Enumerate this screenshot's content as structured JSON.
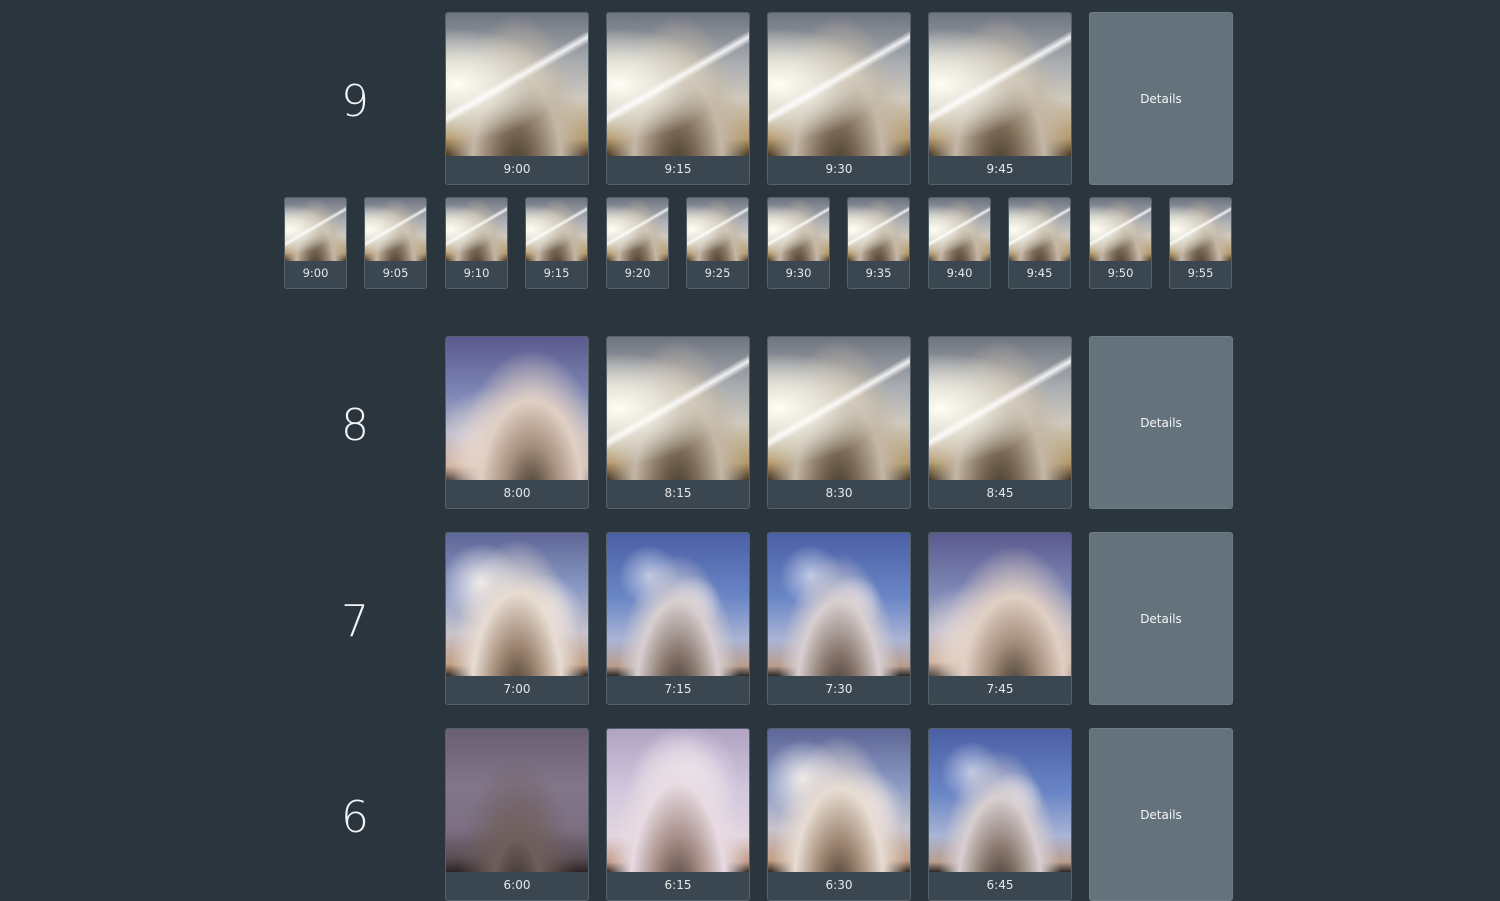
{
  "hours": [
    {
      "label": "9",
      "quarters": [
        "9:00",
        "9:15",
        "9:30",
        "9:45"
      ],
      "details_label": "Details",
      "minutes": [
        "9:00",
        "9:05",
        "9:10",
        "9:15",
        "9:20",
        "9:25",
        "9:30",
        "9:35",
        "9:40",
        "9:45",
        "9:50",
        "9:55"
      ]
    },
    {
      "label": "8",
      "quarters": [
        "8:00",
        "8:15",
        "8:30",
        "8:45"
      ],
      "details_label": "Details"
    },
    {
      "label": "7",
      "quarters": [
        "7:00",
        "7:15",
        "7:30",
        "7:45"
      ],
      "details_label": "Details"
    },
    {
      "label": "6",
      "quarters": [
        "6:00",
        "6:15",
        "6:30",
        "6:45"
      ],
      "details_label": "Details"
    }
  ],
  "colors": {
    "background": "#2b353d",
    "tile": "#3a4750",
    "details_panel": "#64737b"
  }
}
